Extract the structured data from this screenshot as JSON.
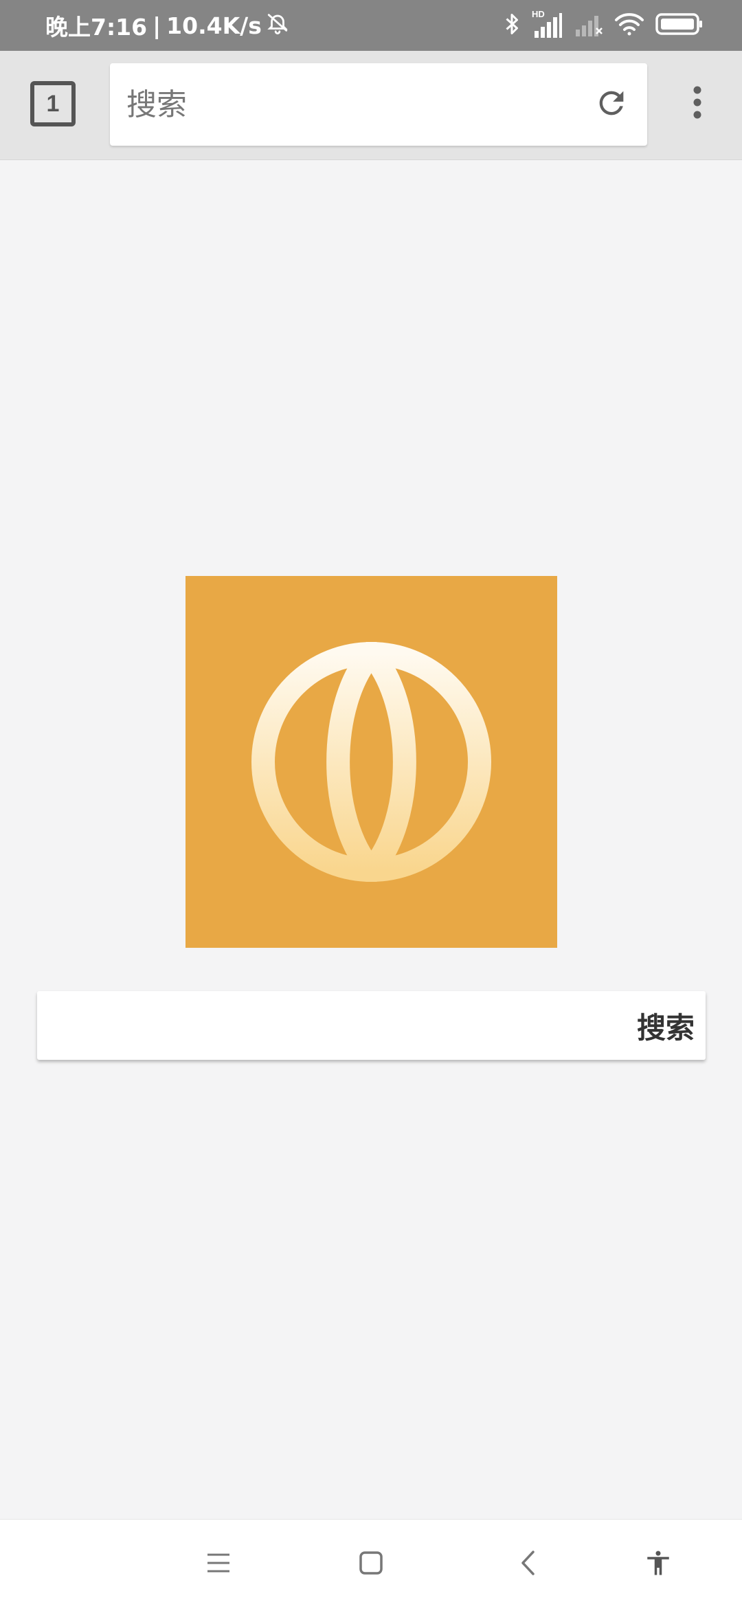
{
  "status_bar": {
    "time": "晚上7:16",
    "separator": "|",
    "network_speed": "10.4K/s",
    "icons": [
      "bell-off-icon",
      "bluetooth-icon",
      "hd-signal-icon",
      "no-signal-icon",
      "wifi-icon",
      "battery-icon"
    ],
    "hd_label": "HD"
  },
  "toolbar": {
    "tab_count": "1",
    "url_placeholder": "搜索",
    "reload_icon": "reload-icon",
    "menu_icon": "more-vert-icon"
  },
  "content": {
    "logo_icon": "globe-icon",
    "logo_color": "#e8a845",
    "search_button_label": "搜索",
    "search_input_value": ""
  },
  "nav_bar": {
    "icons": [
      "menu-lines-icon",
      "home-square-icon",
      "back-chevron-icon",
      "accessibility-icon"
    ]
  }
}
